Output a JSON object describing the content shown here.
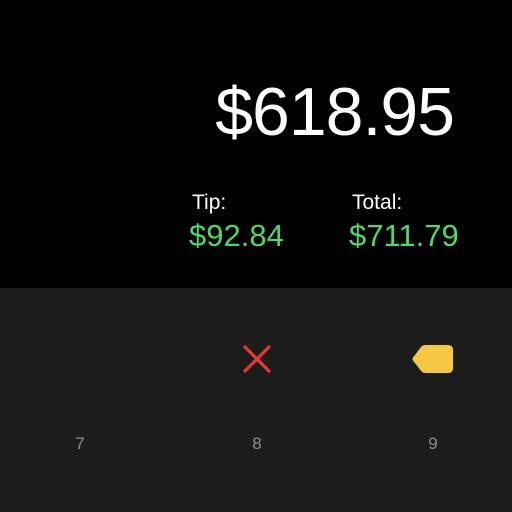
{
  "display": {
    "amount": "$618.95",
    "tip_label": "Tip:",
    "tip_value": "$92.84",
    "total_label": "Total:",
    "total_value": "$711.79"
  },
  "keypad": {
    "keys": [
      "7",
      "8",
      "9"
    ],
    "clear_icon": "close-icon",
    "backspace_icon": "backspace-icon"
  },
  "colors": {
    "background": "#000000",
    "keypad_background": "#1c1c1c",
    "accent_green": "#4cd964",
    "clear_red": "#e8392f",
    "backspace_yellow": "#f4c842",
    "digit_gray": "#8e8e8e"
  }
}
